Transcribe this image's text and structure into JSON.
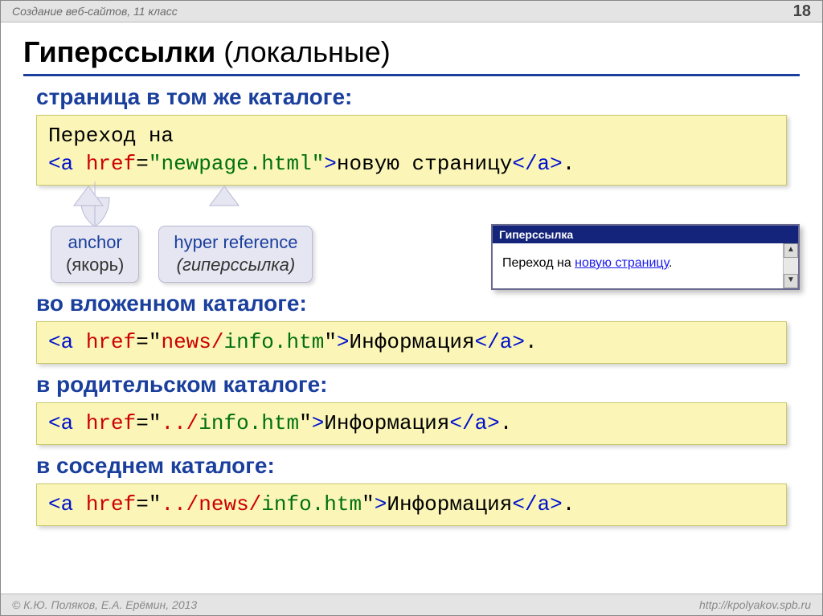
{
  "header": {
    "course": "Создание веб-сайтов, 11 класс",
    "page": "18"
  },
  "title": {
    "bold": "Гиперссылки",
    "rest": " (локальные)"
  },
  "s1": {
    "label": "страница в том же каталоге:",
    "code": {
      "pre": "Переход на ",
      "open1": "<a",
      "sp": " ",
      "attr": "href",
      "eq": "=",
      "val": "\"newpage.html\"",
      "gt": ">",
      "txt": "новую страницу",
      "close": "</a>",
      "dot": "."
    }
  },
  "callouts": {
    "anchor": {
      "en": "anchor",
      "ru": "(якорь)"
    },
    "href": {
      "en": "hyper reference",
      "ru": "(гиперссылка)"
    }
  },
  "browser": {
    "title": "Гиперссылка",
    "text_pre": "Переход на ",
    "link": "новую страницу",
    "text_post": "."
  },
  "s2": {
    "label": "во вложенном каталоге:",
    "code": {
      "open1": "<a",
      "sp": " ",
      "attr": "href",
      "eq": "=",
      "val_q1": "\"",
      "val_dir": "news/",
      "val_file": "info.htm",
      "val_q2": "\"",
      "gt": ">",
      "txt": "Информация",
      "close": "</a>",
      "dot": "."
    }
  },
  "s3": {
    "label": "в родительском каталоге:",
    "code": {
      "open1": "<a",
      "sp": " ",
      "attr": "href",
      "eq": "=",
      "val_q1": "\"",
      "val_dir": "../",
      "val_file": "info.htm",
      "val_q2": "\"",
      "gt": ">",
      "txt": "Информация",
      "close": "</a>",
      "dot": "."
    }
  },
  "s4": {
    "label": "в соседнем каталоге:",
    "code": {
      "open1": "<a",
      "sp": " ",
      "attr": "href",
      "eq": "=",
      "val_q1": "\"",
      "val_dir": "../news/",
      "val_file": "info.htm",
      "val_q2": "\"",
      "gt": ">",
      "txt": "Информация",
      "close": "</a>",
      "dot": "."
    }
  },
  "footer": {
    "copyright": "© К.Ю. Поляков, Е.А. Ерёмин, 2013",
    "url": "http://kpolyakov.spb.ru"
  }
}
